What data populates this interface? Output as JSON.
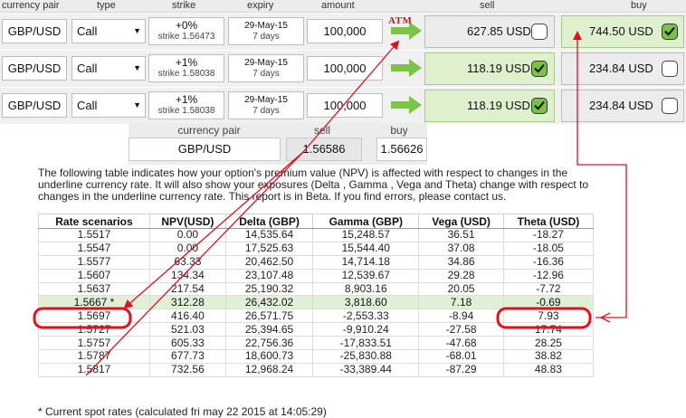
{
  "header": {
    "currency_pair": "currency pair",
    "type": "type",
    "strike": "strike",
    "expiry": "expiry",
    "amount": "amount",
    "sell": "sell",
    "buy": "buy"
  },
  "atm_label": "ATM",
  "rows": [
    {
      "pair": "GBP/USD",
      "type": "Call",
      "strike_pct": "+0%",
      "strike_value": "strike 1.56473",
      "expiry_date": "29-May-15",
      "expiry_days": "7 days",
      "amount": "100,000",
      "sell_price": "627.85 USD",
      "sell_checked": false,
      "buy_price": "744.50 USD",
      "buy_checked": true
    },
    {
      "pair": "GBP/USD",
      "type": "Call",
      "strike_pct": "+1%",
      "strike_value": "strike 1.58038",
      "expiry_date": "29-May-15",
      "expiry_days": "7 days",
      "amount": "100,000",
      "sell_price": "118.19 USD",
      "sell_checked": true,
      "buy_price": "234.84 USD",
      "buy_checked": false
    },
    {
      "pair": "GBP/USD",
      "type": "Call",
      "strike_pct": "+1%",
      "strike_value": "strike 1.58038",
      "expiry_date": "29-May-15",
      "expiry_days": "7 days",
      "amount": "100,000",
      "sell_price": "118.19 USD",
      "sell_checked": true,
      "buy_price": "234.84 USD",
      "buy_checked": false
    }
  ],
  "spot": {
    "pair_label": "currency pair",
    "sell_label": "sell",
    "buy_label": "buy",
    "pair_value": "GBP/USD",
    "sell_value": "1.56586",
    "buy_value": "1.56626"
  },
  "description": "The following table indicates how your option's premium value (NPV) is affected with respect to changes in the underline currency rate. It will also show your exposures (Delta , Gamma , Vega and Theta) change with respect to changes in the underline currency rate. This report is in Beta. If you find errors, please contact us.",
  "table": {
    "headers": [
      "Rate scenarios",
      "NPV(USD)",
      "Delta (GBP)",
      "Gamma (GBP)",
      "Vega (USD)",
      "Theta (USD)"
    ],
    "rows": [
      [
        "1.5517",
        "0.00",
        "14,535.64",
        "15,248.57",
        "36.51",
        "-18.27"
      ],
      [
        "1.5547",
        "0.00",
        "17,525.63",
        "15,544.40",
        "37.08",
        "-18.05"
      ],
      [
        "1.5577",
        "63.33",
        "20,462.50",
        "14,714.18",
        "34.86",
        "-16.36"
      ],
      [
        "1.5607",
        "134.34",
        "23,107.48",
        "12,539.67",
        "29.28",
        "-12.96"
      ],
      [
        "1.5637",
        "217.54",
        "25,190.32",
        "8,903.16",
        "20.05",
        "-7.72"
      ],
      [
        "1.5667 *",
        "312.28",
        "26,432.02",
        "3,818.60",
        "7.18",
        "-0.69"
      ],
      [
        "1.5697",
        "416.40",
        "26,571.75",
        "-2,553.33",
        "-8.94",
        "7.93"
      ],
      [
        "1.5727",
        "521.03",
        "25,394.65",
        "-9,910.24",
        "-27.58",
        "17.74"
      ],
      [
        "1.5757",
        "605.33",
        "22,756.36",
        "-17,833.51",
        "-47.68",
        "28.25"
      ],
      [
        "1.5787",
        "677.73",
        "18,600.73",
        "-25,830.88",
        "-68.01",
        "38.82"
      ],
      [
        "1.5817",
        "732.56",
        "12,968.24",
        "-33,389.44",
        "-87.29",
        "48.83"
      ]
    ],
    "current_row_index": 5
  },
  "footnote": "* Current spot rates (calculated fri may 22 2015 at 14:05:29)",
  "colors": {
    "highlight_green": "#dff0cf",
    "check_green": "#78c24a",
    "arrow_green": "#7cc445",
    "annotation_red": "#e0101e",
    "atm_red": "#d60f24"
  }
}
